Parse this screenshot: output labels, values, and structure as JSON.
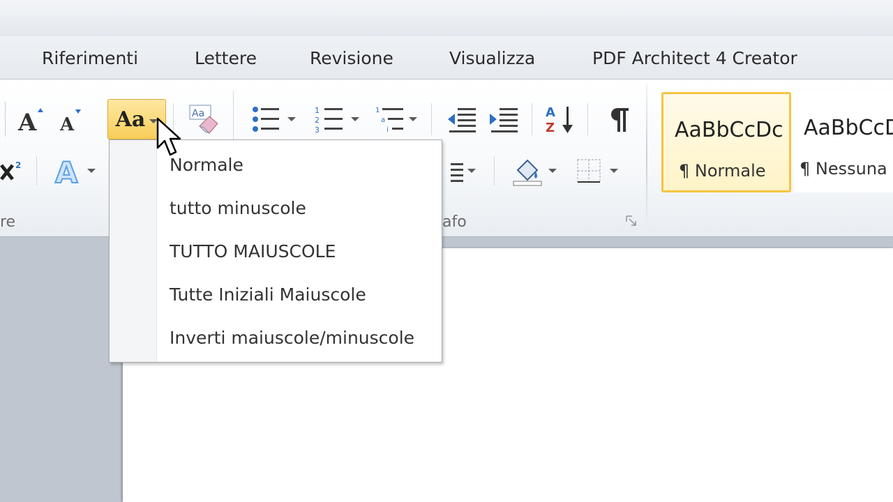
{
  "tabs": [
    {
      "label": "Riferimenti"
    },
    {
      "label": "Lettere"
    },
    {
      "label": "Revisione"
    },
    {
      "label": "Visualizza"
    },
    {
      "label": "PDF Architect 4 Creator"
    }
  ],
  "ribbon": {
    "groups": {
      "font_label_fragment": "re",
      "paragraph_label_fragment": "afo"
    },
    "change_case_button": {
      "label": "Aa"
    },
    "styles": [
      {
        "sample": "AaBbCcDc",
        "name": "¶ Normale",
        "selected": true
      },
      {
        "sample": "AaBbCcD",
        "name": "¶ Nessuna",
        "selected": false
      }
    ]
  },
  "case_menu": {
    "items": [
      {
        "label": "Normale",
        "accel": "N"
      },
      {
        "label": "tutto minuscole",
        "accel": "t"
      },
      {
        "label": "TUTTO MAIUSCOLE",
        "accel": "U"
      },
      {
        "label": "Tutte Iniziali Maiuscole",
        "accel": "z"
      },
      {
        "label": "Inverti maiuscole/minuscole",
        "accel": "I"
      }
    ]
  },
  "colors": {
    "highlight": "#f8cd58",
    "menu_bg": "#ffffff",
    "doc_bg": "#bfc6cf"
  },
  "icons": [
    "grow-font-icon",
    "shrink-font-icon",
    "change-case-icon",
    "clear-formatting-icon",
    "bullets-icon",
    "numbering-icon",
    "multilevel-list-icon",
    "decrease-indent-icon",
    "increase-indent-icon",
    "sort-icon",
    "show-paragraph-marks-icon",
    "superscript-icon",
    "text-effects-icon",
    "line-spacing-icon",
    "shading-icon",
    "borders-icon",
    "dialog-launcher-icon",
    "mouse-cursor-icon"
  ]
}
